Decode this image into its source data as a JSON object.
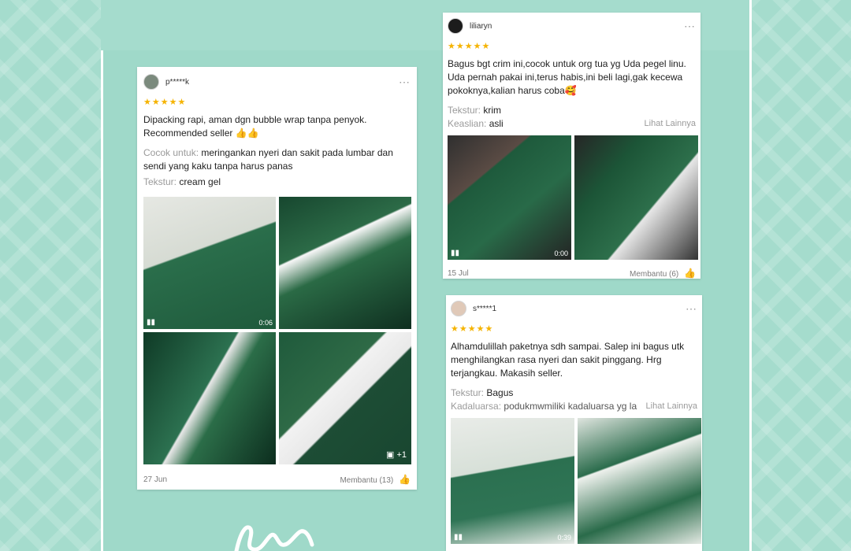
{
  "reviews": {
    "left": {
      "username": "p*****k",
      "stars": "★★★★★",
      "text": "Dipacking rapi, aman dgn bubble wrap tanpa penyok. Recommended seller 👍👍",
      "cocok_label": "Cocok untuk:",
      "cocok_value": "meringankan nyeri dan sakit pada lumbar dan sendi yang kaku tanpa harus panas",
      "tekstur_label": "Tekstur:",
      "tekstur_value": "cream gel",
      "video_duration": "0:06",
      "more_photos": "+1",
      "date": "27 Jun",
      "helpful": "Membantu (13)"
    },
    "top_right": {
      "username": "liliaryn",
      "stars": "★★★★★",
      "text": "Bagus bgt crim ini,cocok untuk org tua yg Uda pegel linu. Uda pernah pakai ini,terus habis,ini beli lagi,gak kecewa pokoknya,kalian harus coba🥰",
      "tekstur_label": "Tekstur:",
      "tekstur_value": "krim",
      "keaslian_label": "Keaslian:",
      "keaslian_value": "asli",
      "lihat": "Lihat Lainnya",
      "video_duration": "0:00",
      "date": "15 Jul",
      "helpful": "Membantu (6)"
    },
    "bottom_right": {
      "username": "s*****1",
      "stars": "★★★★★",
      "text": "Alhamdulillah paketnya sdh sampai. Salep ini bagus utk menghilangkan rasa nyeri dan sakit pinggang. Hrg terjangkau. Makasih seller.",
      "tekstur_label": "Tekstur:",
      "tekstur_value": "Bagus",
      "kadaluarsa_label": "Kadaluarsa:",
      "kadaluarsa_value": "podukmwmiliki kadaluarsa yg lama",
      "lihat": "Lihat Lainnya",
      "video_duration": "0:39"
    }
  },
  "icons": {
    "more": "⋯",
    "thumb_up": "👍",
    "video": "▮▮",
    "gallery": "▣"
  },
  "colors": {
    "background": "#a5dccd",
    "star": "#f5b301",
    "muted": "#9a9a9a"
  }
}
